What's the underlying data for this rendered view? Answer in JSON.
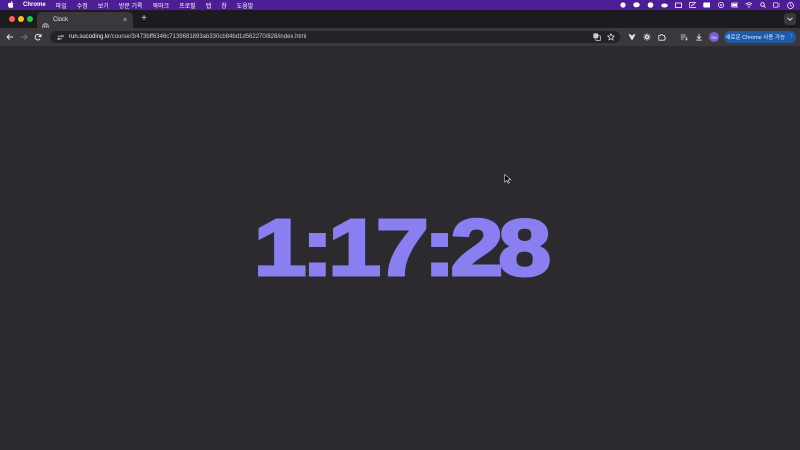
{
  "menubar": {
    "app_name": "Chrome",
    "items": [
      "파일",
      "수정",
      "보기",
      "방문 기록",
      "북마크",
      "프로필",
      "탭",
      "창",
      "도움말"
    ]
  },
  "tab": {
    "title": "Clock",
    "close_glyph": "×"
  },
  "new_tab_glyph": "+",
  "address_bar": {
    "host": "run.sucoding.kr",
    "path": "/course/3/473bff6346c7139681893ab330cb84bd1d562270/828/index.html"
  },
  "profile": {
    "avatar_text": "SN",
    "chrome_button_label": "새로운 Chrome 사용 가능",
    "more_glyph": "⋮"
  },
  "page": {
    "clock_text": "1:17:28"
  },
  "colors": {
    "menubar_bg": "#4c1d95",
    "page_bg": "#2c2a2f",
    "clock_color": "#8a7ff0",
    "update_button_bg": "#1e5aa8"
  }
}
